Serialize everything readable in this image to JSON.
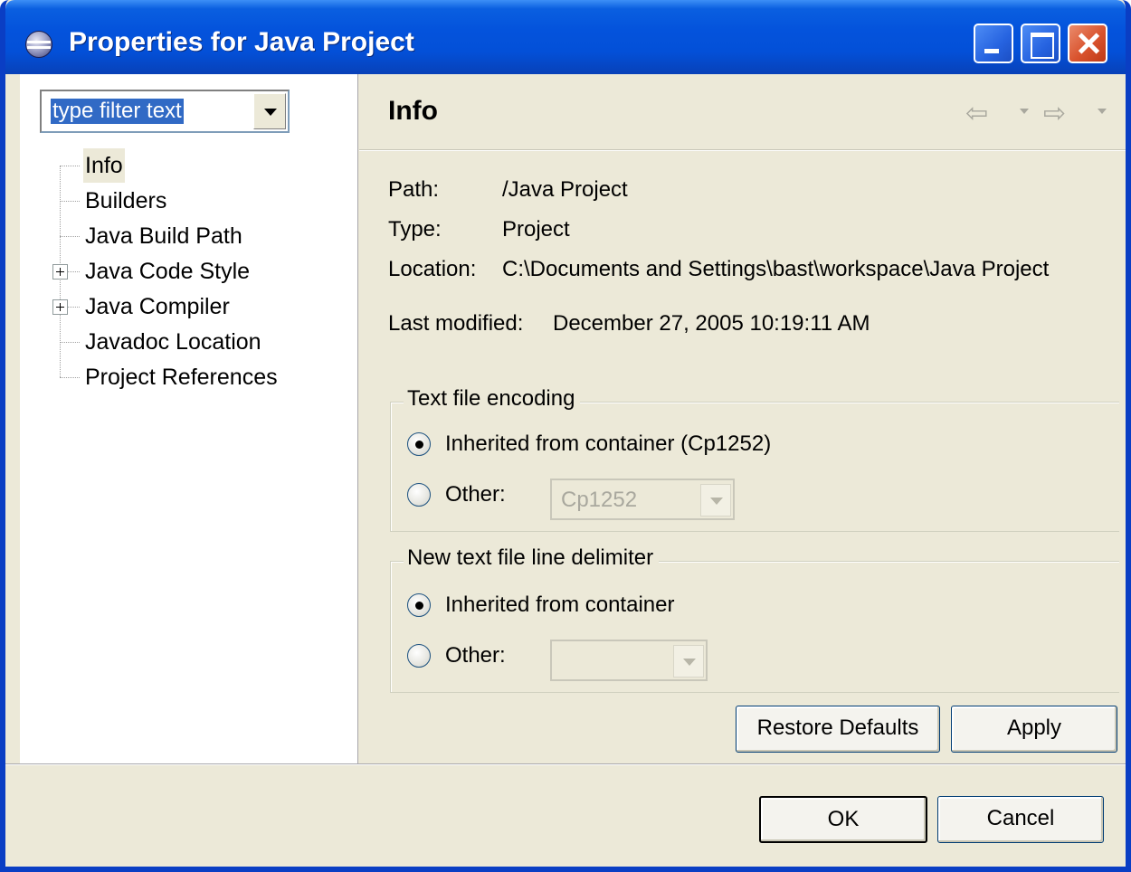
{
  "window": {
    "title": "Properties for Java Project"
  },
  "filter": {
    "text": "type filter text"
  },
  "tree": {
    "items": [
      {
        "label": "Info",
        "selected": true,
        "expandable": false
      },
      {
        "label": "Builders",
        "selected": false,
        "expandable": false
      },
      {
        "label": "Java Build Path",
        "selected": false,
        "expandable": false
      },
      {
        "label": "Java Code Style",
        "selected": false,
        "expandable": true
      },
      {
        "label": "Java Compiler",
        "selected": false,
        "expandable": true
      },
      {
        "label": "Javadoc Location",
        "selected": false,
        "expandable": false
      },
      {
        "label": "Project References",
        "selected": false,
        "expandable": false
      }
    ]
  },
  "page": {
    "title": "Info",
    "path_label": "Path:",
    "path_value": "/Java Project",
    "type_label": "Type:",
    "type_value": "Project",
    "location_label": "Location:",
    "location_value": "C:\\Documents and Settings\\bast\\workspace\\Java Project",
    "modified_label": "Last modified:",
    "modified_value": "December 27, 2005 10:19:11 AM"
  },
  "encoding": {
    "title": "Text file encoding",
    "inherited_label": "Inherited from container (Cp1252)",
    "other_label": "Other:",
    "other_value": "Cp1252",
    "selected": "inherited"
  },
  "delimiter": {
    "title": "New text file line delimiter",
    "inherited_label": "Inherited from container",
    "other_label": "Other:",
    "other_value": "",
    "selected": "inherited"
  },
  "buttons": {
    "restore_defaults": "Restore Defaults",
    "apply": "Apply",
    "ok": "OK",
    "cancel": "Cancel"
  },
  "icons": {
    "app": "eclipse-icon",
    "back": "back-arrow-icon",
    "forward": "forward-arrow-icon",
    "minimize": "minimize-icon",
    "maximize": "maximize-icon",
    "close": "close-icon"
  },
  "colors": {
    "titlebar": "#0453dc",
    "selection": "#316ac5",
    "dialog_bg": "#ece9d8",
    "close_button": "#d9532e"
  }
}
